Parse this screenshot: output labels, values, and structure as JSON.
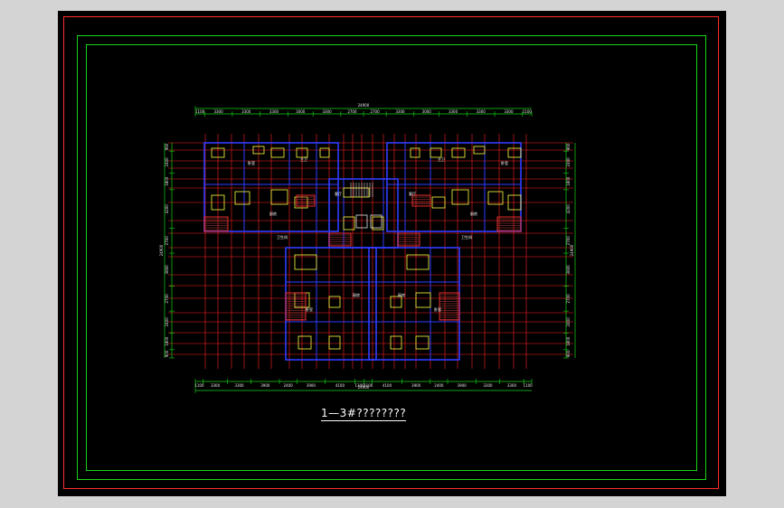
{
  "drawing": {
    "title": "1—3#????????",
    "colors": {
      "background": "#000000",
      "frame_red": "#ff2a2a",
      "frame_green": "#15d615",
      "axis_lines": "#ff2020",
      "walls": "#2f3cff",
      "dimension": "#15d615",
      "furniture": "#ffff40",
      "balcony": "#ff3030",
      "hatch": "#c04040"
    },
    "top_dimensions": {
      "overall": "24900",
      "segments": [
        "1100",
        "3300",
        "3300",
        "3300",
        "3000",
        "3300",
        "2700",
        "2700",
        "3300",
        "3000",
        "3300",
        "3300",
        "3300",
        "1100"
      ]
    },
    "bottom_dimensions": {
      "overall": "24900",
      "segments": [
        "1100",
        "3300",
        "3300",
        "3900",
        "2400",
        "3900",
        "4100",
        "1300",
        "1100",
        "4100",
        "3900",
        "2400",
        "3900",
        "3300",
        "3300",
        "1100"
      ]
    },
    "left_dimensions": {
      "overall": "24900",
      "segments": [
        "900",
        "2400",
        "1800",
        "4200",
        "2700",
        "3600",
        "2700",
        "2400",
        "1800",
        "900"
      ]
    },
    "right_dimensions": {
      "overall": "24900",
      "segments": [
        "900",
        "2400",
        "1800",
        "4200",
        "2700",
        "3600",
        "2700",
        "2400",
        "1800",
        "900"
      ]
    },
    "room_labels": [
      "卧室",
      "卧室",
      "卧室",
      "卧室",
      "厨房",
      "厨房",
      "厨房",
      "厨房",
      "主卫",
      "主卫",
      "客厅",
      "客厅",
      "卫生间",
      "卫生间"
    ]
  }
}
